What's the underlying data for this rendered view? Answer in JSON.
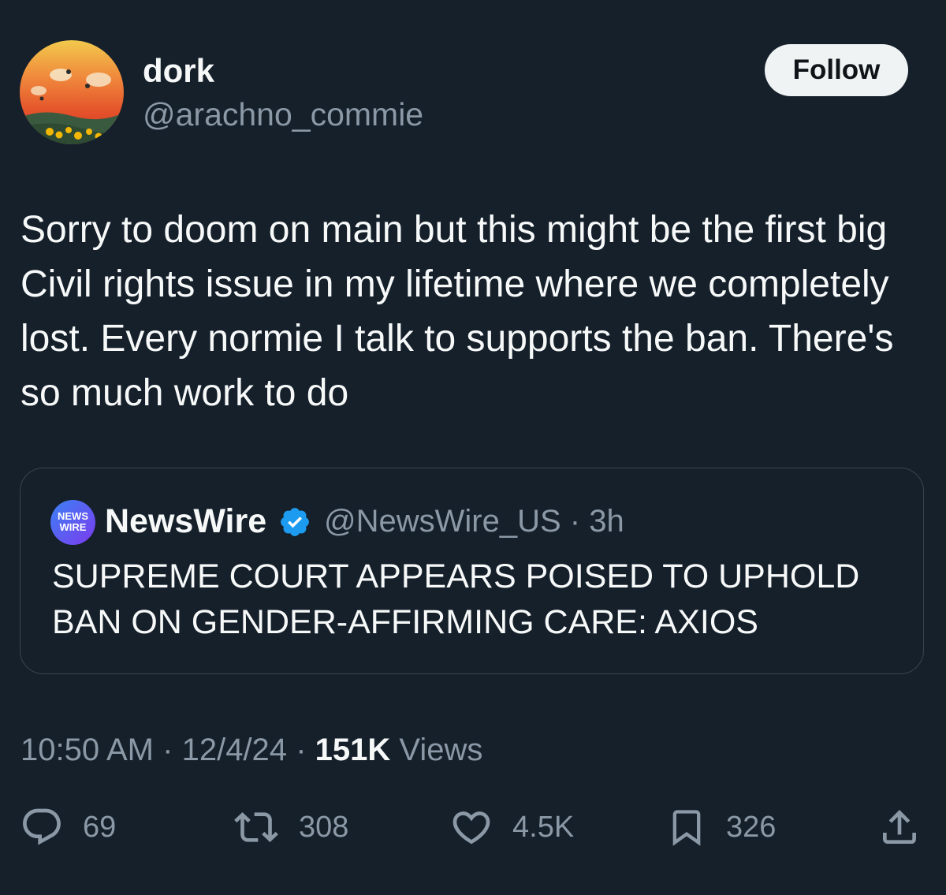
{
  "author": {
    "display_name": "dork",
    "handle": "@arachno_commie",
    "avatar_icon": "sunset-sunflower-field-avatar"
  },
  "follow_button": {
    "label": "Follow"
  },
  "tweet": {
    "text": "Sorry to doom on main but this might be the first big Civil rights issue in my lifetime where we completely lost. Every normie I talk to supports the ban. There's so much work to do"
  },
  "quoted_tweet": {
    "avatar_text_top": "NEWS",
    "avatar_text_bottom": "WIRE",
    "display_name": "NewsWire",
    "verified_icon": "verified-badge-icon",
    "handle_time": "@NewsWire_US · 3h",
    "text": "SUPREME COURT APPEARS POISED TO UPHOLD BAN ON GENDER-AFFIRMING CARE: AXIOS"
  },
  "meta": {
    "time": "10:50 AM",
    "date": "12/4/24",
    "separator": "·",
    "views_count": "151K",
    "views_label": "Views"
  },
  "actions": {
    "replies": "69",
    "reposts": "308",
    "likes": "4.5K",
    "bookmarks": "326"
  },
  "colors": {
    "background": "#15202b",
    "text_primary": "#f7f9f9",
    "text_secondary": "#8b98a5",
    "border": "#38444d",
    "verified_blue": "#1d9bf0",
    "follow_bg": "#eff3f4"
  }
}
